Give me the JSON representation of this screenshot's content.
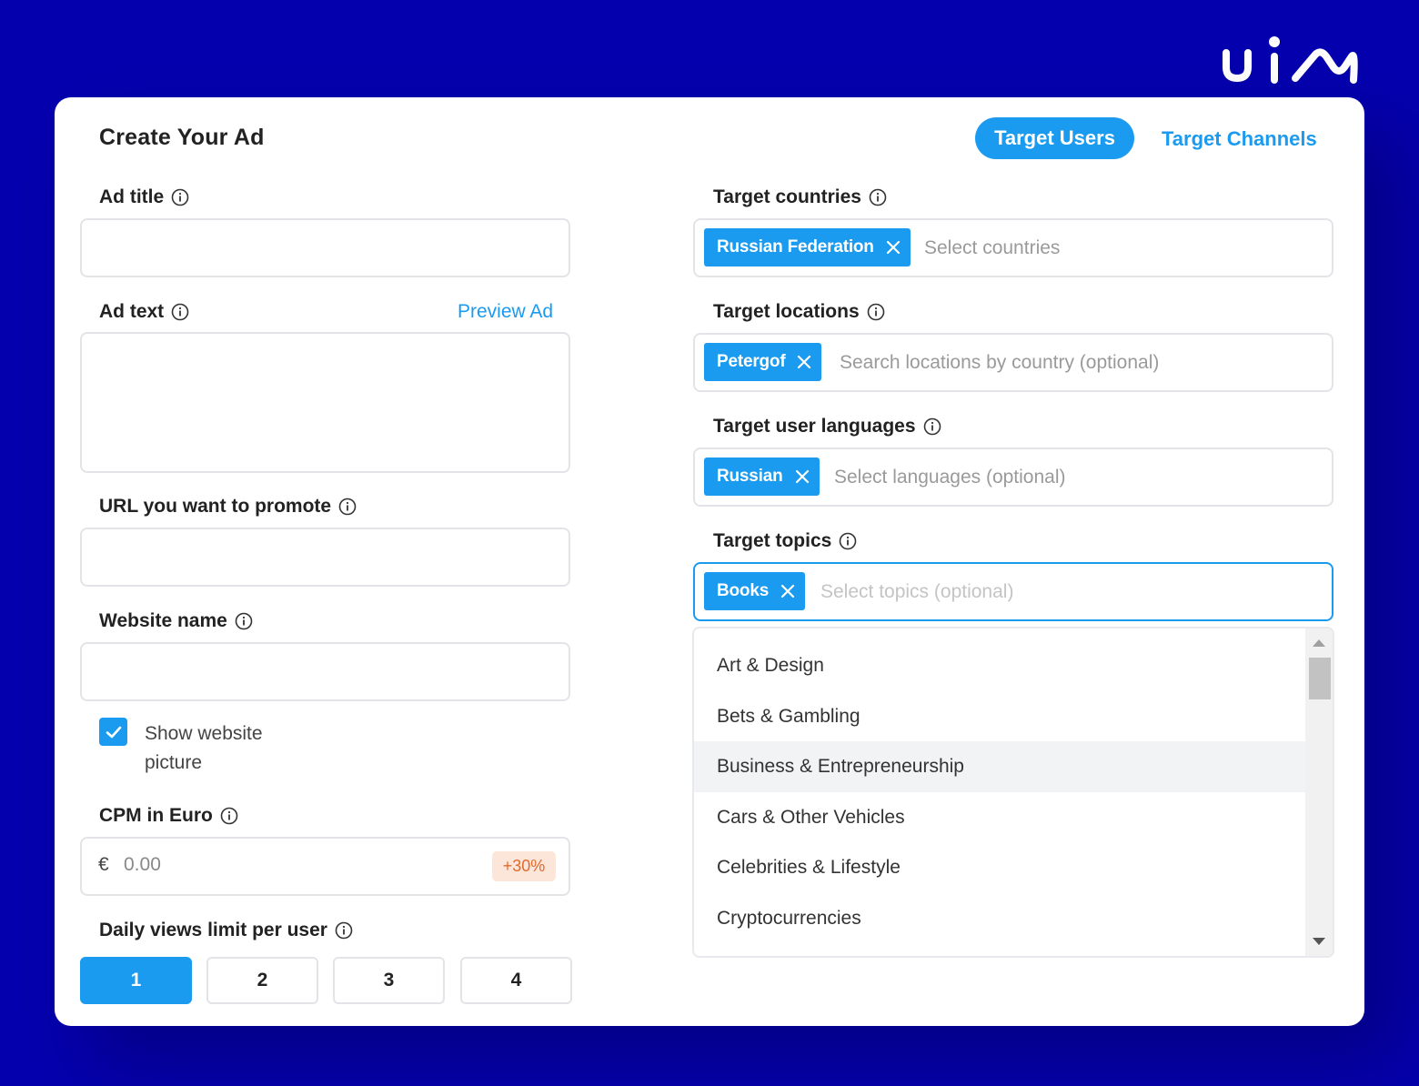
{
  "brand": {
    "logo": "uim-logo",
    "bg_color": "#0500AE",
    "accent": "#1A9BF0"
  },
  "header": {
    "title": "Create Your Ad",
    "tabs": [
      {
        "label": "Target Users",
        "active": true
      },
      {
        "label": "Target Channels",
        "active": false
      }
    ]
  },
  "left": {
    "ad_title": {
      "label": "Ad title",
      "value": ""
    },
    "ad_text": {
      "label": "Ad text",
      "preview_link": "Preview Ad",
      "value": ""
    },
    "url": {
      "label": "URL you want to promote",
      "value": ""
    },
    "website_name": {
      "label": "Website name",
      "value": ""
    },
    "show_picture": {
      "checked": true,
      "label": "Show website picture"
    },
    "cpm": {
      "label": "CPM in Euro",
      "prefix": "€",
      "placeholder": "0.00",
      "badge": "+30%"
    },
    "daily_views": {
      "label": "Daily views limit per user",
      "options": [
        "1",
        "2",
        "3",
        "4"
      ],
      "selected": "1"
    }
  },
  "right": {
    "countries": {
      "label": "Target countries",
      "tags": [
        "Russian Federation"
      ],
      "placeholder": "Select countries"
    },
    "locations": {
      "label": "Target locations",
      "tags": [
        "Petergof"
      ],
      "placeholder": "Search locations by country (optional)"
    },
    "languages": {
      "label": "Target user languages",
      "tags": [
        "Russian"
      ],
      "placeholder": "Select languages (optional)"
    },
    "topics": {
      "label": "Target topics",
      "tags": [
        "Books"
      ],
      "placeholder": "Select topics (optional)",
      "options": [
        "Art & Design",
        "Bets & Gambling",
        "Business & Entrepreneurship",
        "Cars & Other Vehicles",
        "Celebrities & Lifestyle",
        "Cryptocurrencies"
      ],
      "highlighted": "Business & Entrepreneurship"
    }
  }
}
